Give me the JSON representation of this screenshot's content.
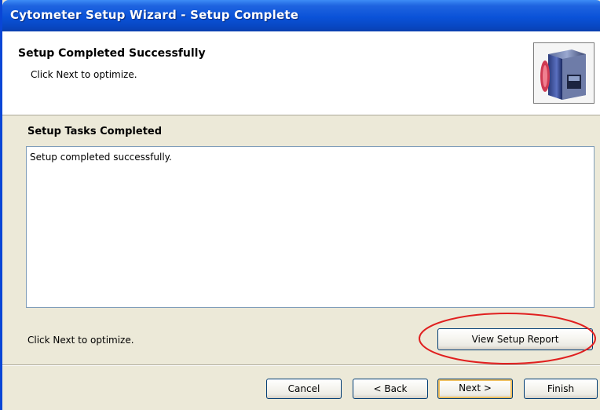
{
  "window": {
    "title": "Cytometer Setup Wizard - Setup Complete"
  },
  "header": {
    "heading": "Setup Completed Successfully",
    "subheading": "Click Next to optimize.",
    "logo_icon": "cytometer-instrument-icon"
  },
  "section": {
    "title": "Setup Tasks Completed",
    "log_text": "Setup completed successfully."
  },
  "footer": {
    "note": "Click Next to optimize.",
    "report_button": "View Setup Report"
  },
  "buttons": {
    "cancel": "Cancel",
    "back": "< Back",
    "next": "Next >",
    "finish": "Finish"
  },
  "colors": {
    "titlebar": "#0a52d8",
    "highlight": "#e02020"
  }
}
